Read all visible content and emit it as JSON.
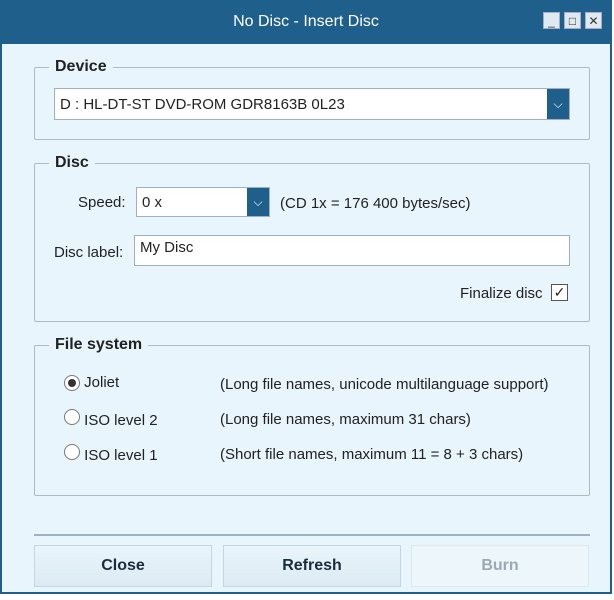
{
  "window": {
    "title": "No Disc - Insert Disc",
    "minimize": "_",
    "maximize": "□",
    "close": "✕"
  },
  "device": {
    "legend": "Device",
    "selected": "D : HL-DT-ST DVD-ROM GDR8163B 0L23"
  },
  "disc": {
    "legend": "Disc",
    "speed_label": "Speed:",
    "speed_value": "0 x",
    "speed_note": "(CD 1x = 176 400 bytes/sec)",
    "label_label": "Disc label:",
    "label_value": "My Disc",
    "finalize_label": "Finalize disc",
    "finalize_checked": true
  },
  "filesystem": {
    "legend": "File system",
    "options": [
      {
        "label": "Joliet",
        "desc": "(Long file names, unicode multilanguage support)",
        "selected": true
      },
      {
        "label": "ISO level 2",
        "desc": "(Long file names, maximum 31 chars)",
        "selected": false
      },
      {
        "label": "ISO level 1",
        "desc": "(Short file names, maximum 11 =  8 + 3 chars)",
        "selected": false
      }
    ]
  },
  "buttons": {
    "close": "Close",
    "refresh": "Refresh",
    "burn": "Burn"
  }
}
